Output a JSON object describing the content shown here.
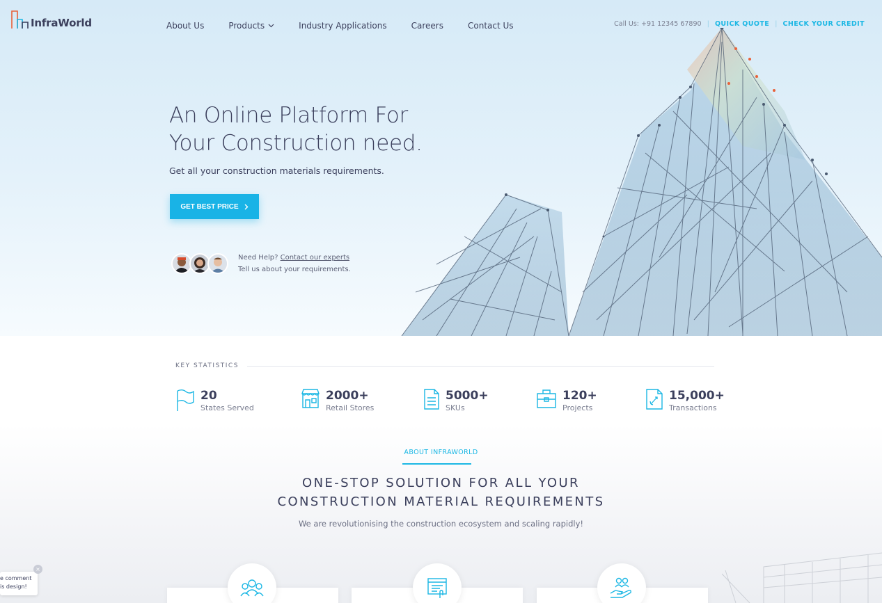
{
  "brand": {
    "name": "InfraWorld"
  },
  "nav": {
    "items": [
      {
        "label": "About Us"
      },
      {
        "label": "Products"
      },
      {
        "label": "Industry Applications"
      },
      {
        "label": "Careers"
      },
      {
        "label": "Contact Us"
      }
    ]
  },
  "topbar": {
    "call": "Call Us: +91 12345 67890",
    "quick_quote": "QUICK QUOTE",
    "check_credit": "CHECK YOUR CREDIT"
  },
  "hero": {
    "title_line1": "An Online Platform For",
    "title_line2": "Your Construction need.",
    "subtitle": "Get all your construction materials requirements.",
    "cta": "GET BEST PRICE",
    "help_prefix": "Need Help?",
    "help_link": "Contact our experts",
    "help_sub": "Tell us about your requirements."
  },
  "stats": {
    "header": "KEY STATISTICS",
    "items": [
      {
        "value": "20",
        "label": "States Served",
        "icon": "flag-icon"
      },
      {
        "value": "2000+",
        "label": "Retail Stores",
        "icon": "store-icon"
      },
      {
        "value": "5000+",
        "label": "SKUs",
        "icon": "document-icon"
      },
      {
        "value": "120+",
        "label": "Projects",
        "icon": "toolbox-icon"
      },
      {
        "value": "15,000+",
        "label": "Transactions",
        "icon": "rocket-icon"
      }
    ]
  },
  "about": {
    "kicker": "ABOUT INFRAWORLD",
    "title_line1": "ONE-STOP SOLUTION FOR ALL YOUR",
    "title_line2": "CONSTRUCTION MATERIAL REQUIREMENTS",
    "subtitle": "We are revolutionising the construction ecosystem and scaling rapidly!"
  },
  "comment_widget": {
    "line1": "e comment",
    "line2": "is design!",
    "close": "×"
  },
  "colors": {
    "accent": "#19b3e6",
    "text": "#3b3f5c",
    "logo_orange": "#e8623a"
  }
}
